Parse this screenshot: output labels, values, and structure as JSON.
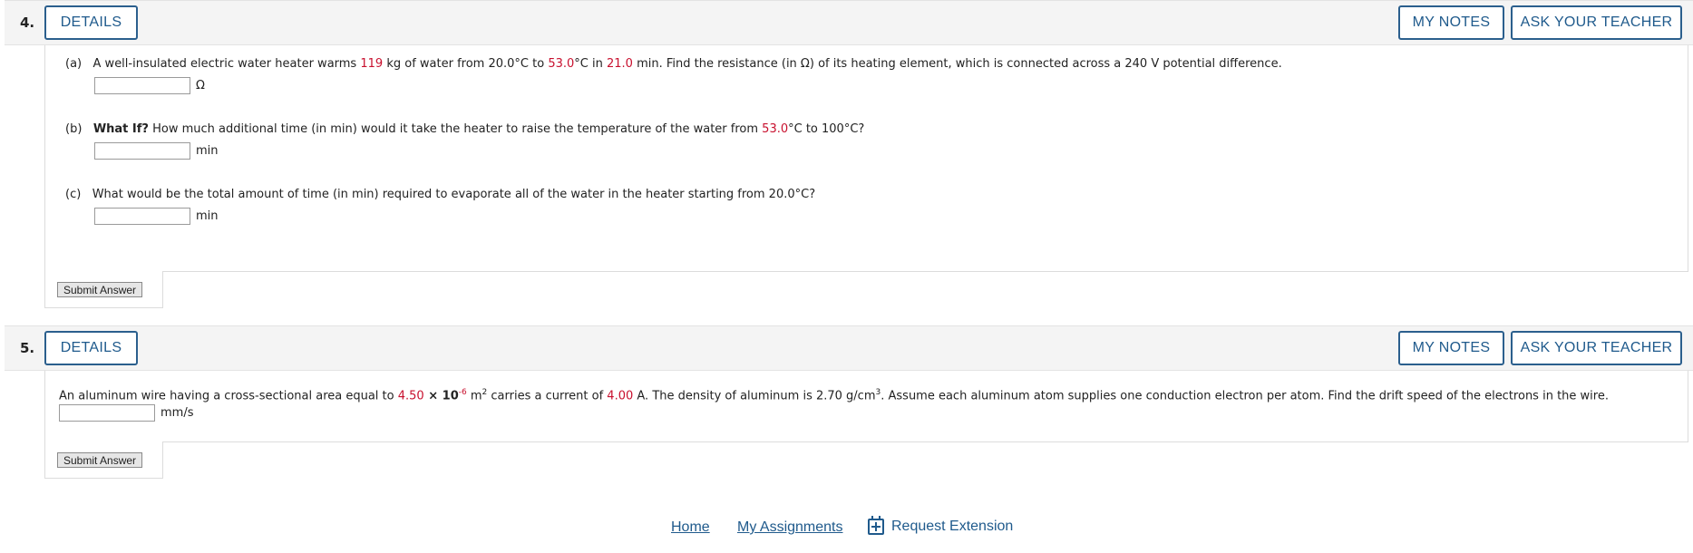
{
  "q4": {
    "number": "4.",
    "details_label": "DETAILS",
    "my_notes_label": "MY NOTES",
    "ask_teacher_label": "ASK YOUR TEACHER",
    "a": {
      "tag": "(a)",
      "t1": "A well-insulated electric water heater warms",
      "mass": "119",
      "t2": "kg of water from 20.0°C to",
      "temp": "53.0",
      "t3": "°C in",
      "time": "21.0",
      "t4": "min. Find the resistance (in Ω) of its heating element, which is connected across a 240 V potential difference.",
      "unit": "Ω",
      "value": ""
    },
    "b": {
      "tag": "(b)",
      "bold": "What If?",
      "t1": "How much additional time (in min) would it take the heater to raise the temperature of the water from",
      "temp": "53.0",
      "t2": "°C to 100°C?",
      "unit": "min",
      "value": ""
    },
    "c": {
      "tag": "(c)",
      "t1": "What would be the total amount of time (in min) required to evaporate all of the water in the heater starting from 20.0°C?",
      "unit": "min",
      "value": ""
    },
    "submit_label": "Submit Answer"
  },
  "q5": {
    "number": "5.",
    "details_label": "DETAILS",
    "my_notes_label": "MY NOTES",
    "ask_teacher_label": "ASK YOUR TEACHER",
    "t1": "An aluminum wire having a cross-sectional area equal to",
    "area": "4.50",
    "times": " × 10",
    "exp": "-6",
    "t2": " m",
    "sq": "2",
    "t3": " carries a current of",
    "current": "4.00",
    "t4": "A. The density of aluminum is 2.70 g/cm",
    "cube": "3",
    "t5": ". Assume each aluminum atom supplies one conduction electron per atom. Find the drift speed of the electrons in the wire.",
    "unit": "mm/s",
    "value": "",
    "submit_label": "Submit Answer"
  },
  "footer": {
    "home": "Home",
    "my_assignments": "My Assignments",
    "request_extension": "Request Extension"
  },
  "colors": {
    "accent": "#1f5a8c",
    "highlight": "#c8102e"
  }
}
